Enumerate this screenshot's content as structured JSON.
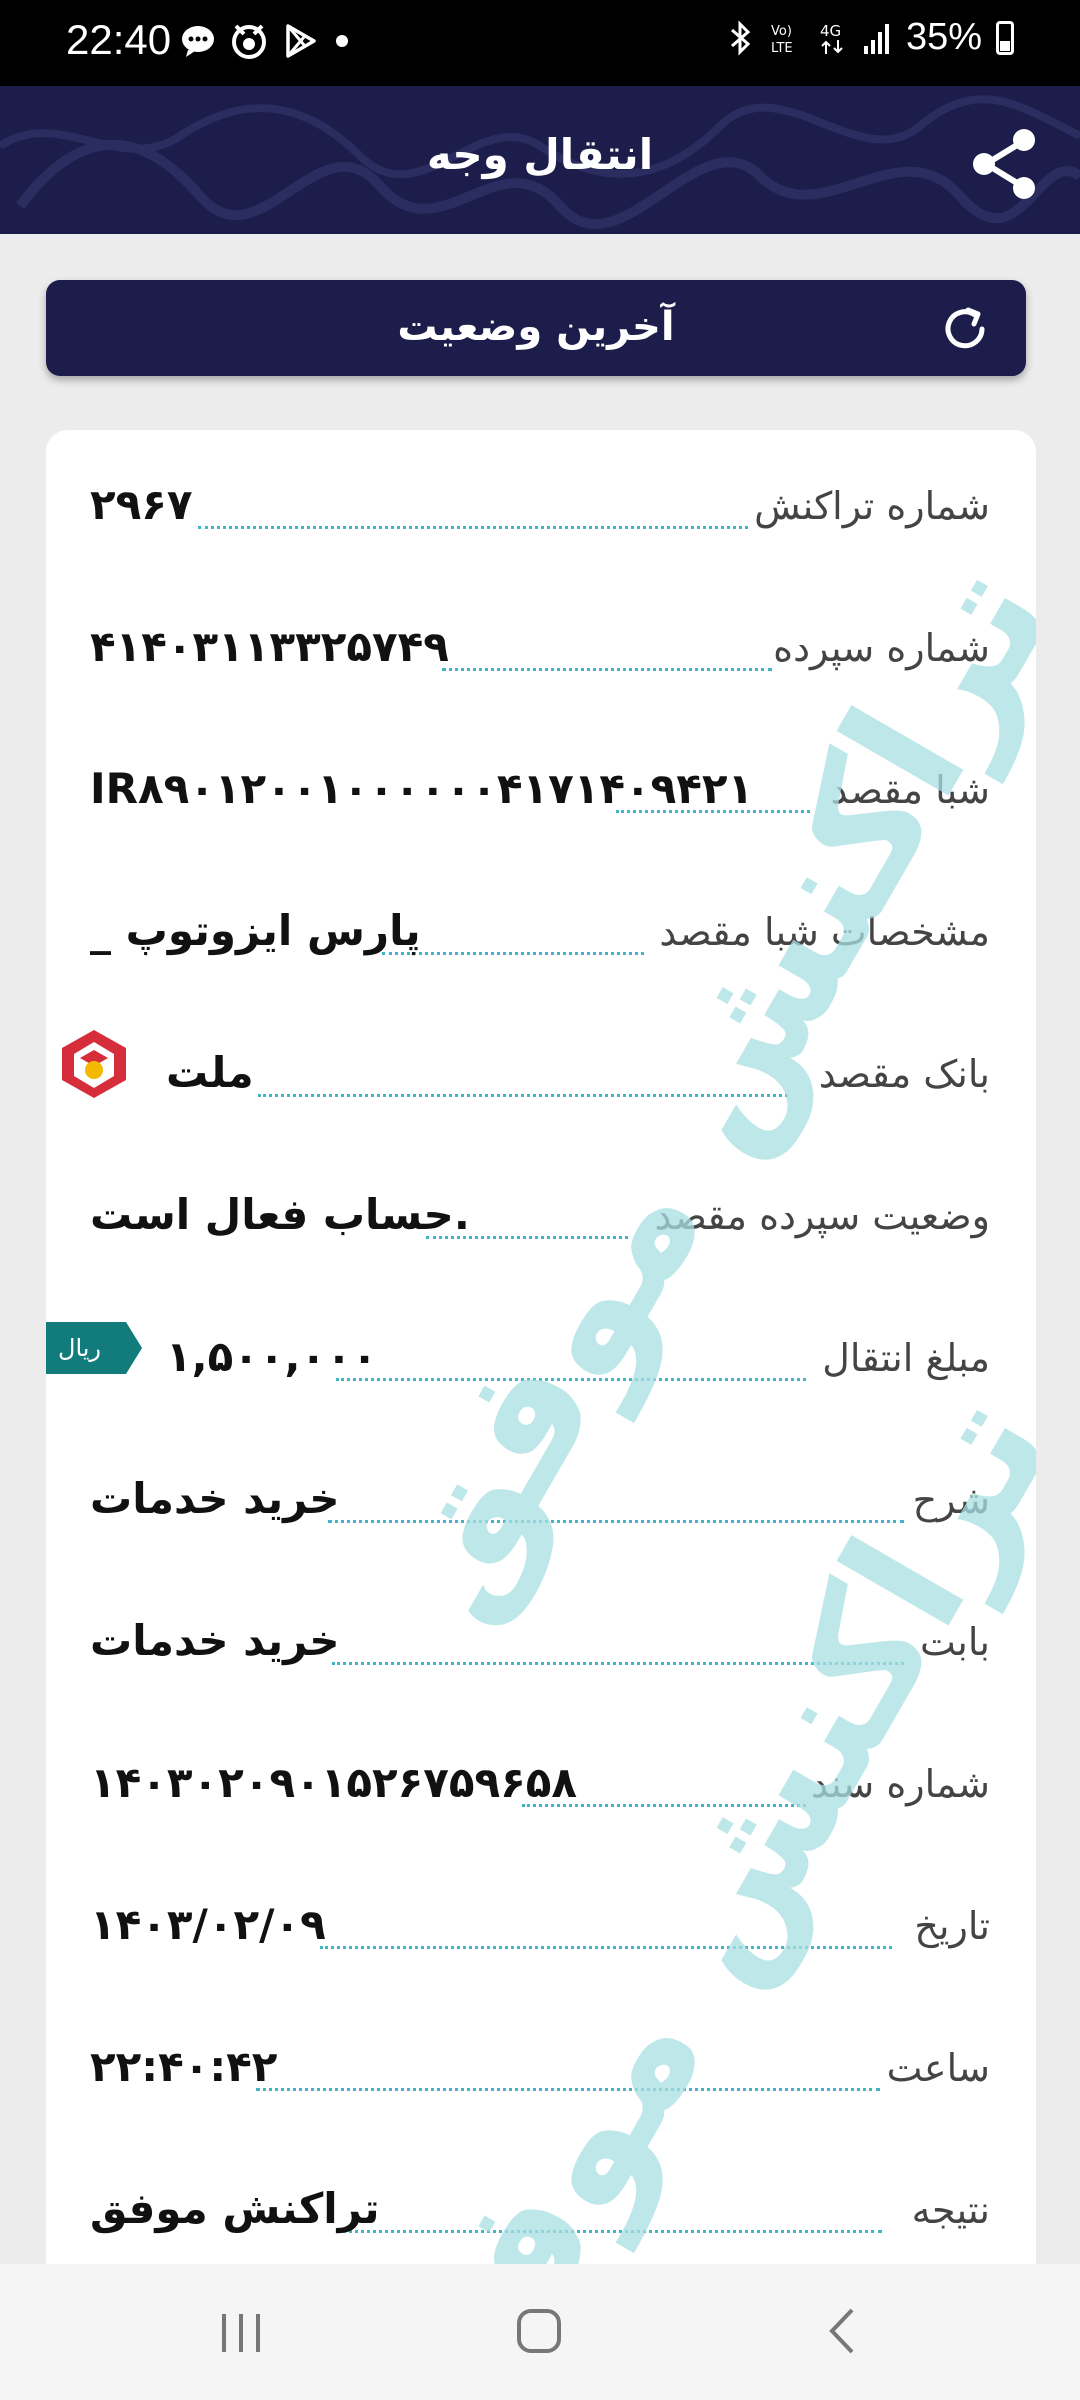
{
  "status_bar": {
    "time": "22:40",
    "network_4g": "4G",
    "volte": "VoLTE",
    "battery": "35%",
    "icons": [
      "chat-icon",
      "fox-app-icon",
      "play-store-icon",
      "dot-icon",
      "bluetooth-icon",
      "signal-icon",
      "battery-icon"
    ]
  },
  "header": {
    "title": "انتقال وجه",
    "share_icon": "share-icon",
    "color": "#1c1d4a"
  },
  "refresh_button": {
    "label": "آخرین وضعیت",
    "icon": "refresh-icon"
  },
  "details": [
    {
      "label": "شماره تراکنش",
      "value": "۲۹۶۷"
    },
    {
      "label": "شماره سپرده",
      "value": "۴۱۴۰۳۱۱۳۳۲۵۷۴۹"
    },
    {
      "label": "شبا مقصد",
      "value": "IR۸۹۰۱۲۰۰۱۰۰۰۰۰۰۴۱۷۱۴۰۹۴۲۱"
    },
    {
      "label": "مشخصات شبا مقصد",
      "value": "_ پارس ایزوتوپ"
    },
    {
      "label": "بانک مقصد",
      "value": "ملت"
    },
    {
      "label": "وضعیت سپرده مقصد",
      "value": "حساب فعال است."
    },
    {
      "label": "مبلغ انتقال",
      "value": "۱,۵۰۰,۰۰۰"
    },
    {
      "label": "شرح",
      "value": "خرید خدمات"
    },
    {
      "label": "بابت",
      "value": "خرید خدمات"
    },
    {
      "label": "شماره سند",
      "value": "۱۴۰۳۰۲۰۹۰۱۵۲۶۷۵۹۶۵۸"
    },
    {
      "label": "تاریخ",
      "value": "۱۴۰۳/۰۲/۰۹"
    },
    {
      "label": "ساعت",
      "value": "۲۲:۴۰:۴۲"
    },
    {
      "label": "نتیجه",
      "value": "تراکنش موفق"
    }
  ],
  "currency": "ریال",
  "watermark": "تراکنش موفق",
  "colors": {
    "accent": "#3fb6c8",
    "currency_badge": "#127b7b",
    "bank_logo": "#d62d3a"
  }
}
